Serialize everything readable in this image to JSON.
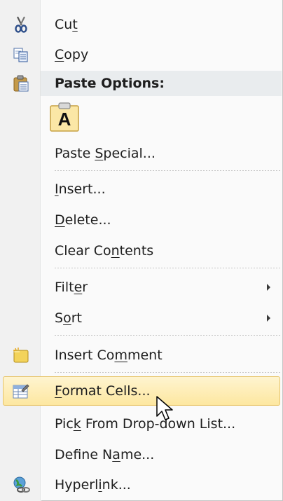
{
  "menu": {
    "cut": {
      "pre": "Cu",
      "ul": "t",
      "post": ""
    },
    "copy": {
      "pre": "",
      "ul": "C",
      "post": "opy"
    },
    "paste_options_header": "Paste Options:",
    "paste_keep_text_glyph": "A",
    "paste_special": {
      "pre": "Paste ",
      "ul": "S",
      "post": "pecial..."
    },
    "insert": {
      "pre": "",
      "ul": "I",
      "post": "nsert..."
    },
    "delete": {
      "pre": "",
      "ul": "D",
      "post": "elete..."
    },
    "clear_contents": {
      "pre": "Clear Co",
      "ul": "n",
      "post": "tents"
    },
    "filter": {
      "pre": "Filt",
      "ul": "e",
      "post": "r"
    },
    "sort": {
      "pre": "S",
      "ul": "o",
      "post": "rt"
    },
    "insert_comment": {
      "pre": "Insert Co",
      "ul": "m",
      "post": "ment"
    },
    "format_cells": {
      "pre": "",
      "ul": "F",
      "post": "ormat Cells..."
    },
    "pick_from_list": {
      "pre": "Pic",
      "ul": "k",
      "post": " From Drop-down List..."
    },
    "define_name": {
      "pre": "Define N",
      "ul": "a",
      "post": "me..."
    },
    "hyperlink": {
      "pre": "Hyperl",
      "ul": "i",
      "post": "nk..."
    }
  },
  "icons": {
    "cut": "scissors-icon",
    "copy": "copy-icon",
    "paste": "clipboard-paste-icon",
    "insert_comment": "comment-icon",
    "format_cells": "format-cells-icon",
    "hyperlink": "hyperlink-globe-icon"
  },
  "colors": {
    "highlight_top": "#fef4d0",
    "highlight_bottom": "#fde7a0",
    "highlight_border": "#e7c46a",
    "header_bg": "#e9ecee"
  },
  "hovered_item": "format_cells"
}
